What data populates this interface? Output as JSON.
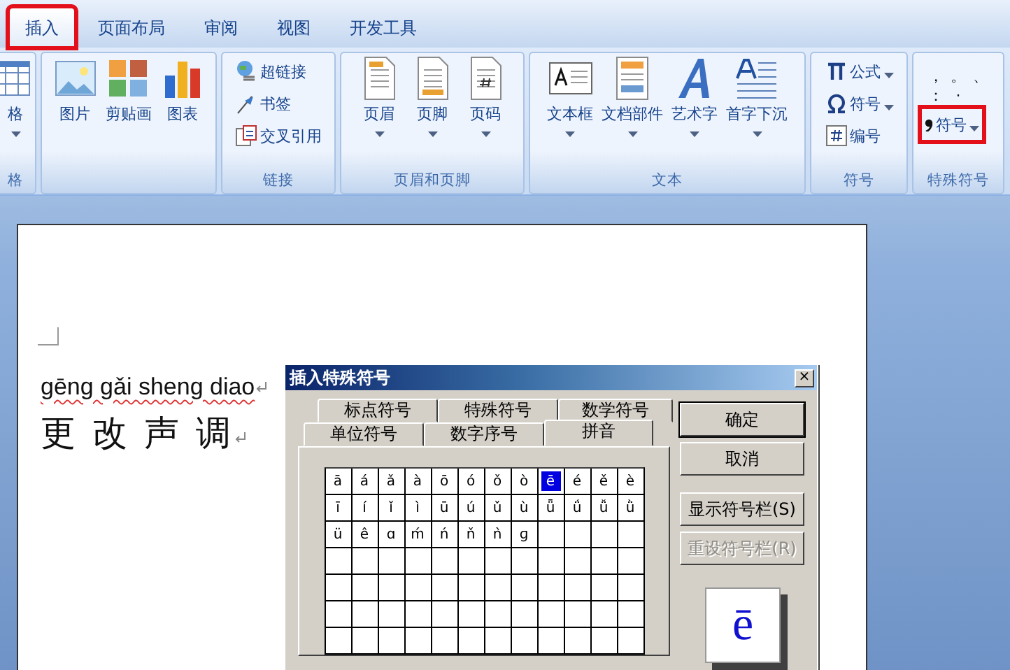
{
  "ribbon_tabs": [
    {
      "label": "插入",
      "selected": true,
      "highlighted": true
    },
    {
      "label": "页面布局",
      "selected": false,
      "highlighted": false
    },
    {
      "label": "审阅",
      "selected": false,
      "highlighted": false
    },
    {
      "label": "视图",
      "selected": false,
      "highlighted": false
    },
    {
      "label": "开发工具",
      "selected": false,
      "highlighted": false
    }
  ],
  "groups": [
    {
      "label": "格",
      "items": [
        {
          "kind": "large",
          "label": "格",
          "caret": true
        }
      ]
    },
    {
      "items": [
        {
          "kind": "large",
          "label": "图片",
          "caret": false
        },
        {
          "kind": "large",
          "label": "剪贴画",
          "caret": false
        },
        {
          "kind": "large",
          "label": "图表",
          "caret": false
        }
      ]
    },
    {
      "label": "链接",
      "items": [
        {
          "kind": "small",
          "label": "超链接",
          "caret": false
        },
        {
          "kind": "small",
          "label": "书签",
          "caret": false
        },
        {
          "kind": "small",
          "label": "交叉引用",
          "caret": false
        }
      ]
    },
    {
      "label": "页眉和页脚",
      "items": [
        {
          "kind": "large",
          "label": "页眉",
          "caret": true
        },
        {
          "kind": "large",
          "label": "页脚",
          "caret": true
        },
        {
          "kind": "large",
          "label": "页码",
          "caret": true
        }
      ]
    },
    {
      "label": "文本",
      "items": [
        {
          "kind": "large",
          "label": "文本框",
          "caret": true
        },
        {
          "kind": "large",
          "label": "文档部件",
          "caret": true
        },
        {
          "kind": "large",
          "label": "艺术字",
          "caret": true
        },
        {
          "kind": "large",
          "label": "首字下沉",
          "caret": true
        }
      ]
    },
    {
      "label": "符号",
      "items": [
        {
          "kind": "small",
          "label": "公式",
          "caret": true
        },
        {
          "kind": "small",
          "label": "符号",
          "caret": true
        },
        {
          "kind": "small",
          "label": "编号",
          "caret": false
        }
      ]
    },
    {
      "label": "特殊符号",
      "items": [
        {
          "kind": "punct",
          "label": "，"
        },
        {
          "kind": "punct",
          "label": "。"
        },
        {
          "kind": "punct",
          "label": "、"
        },
        {
          "kind": "punct",
          "label": "："
        },
        {
          "kind": "punct",
          "label": "·"
        },
        {
          "kind": "bullet",
          "label": "符号",
          "caret": true,
          "highlighted": true
        }
      ]
    }
  ],
  "document": {
    "lines": [
      "gēng gǎi sheng diao",
      "更 改 声 调"
    ]
  },
  "dialog": {
    "title": "插入特殊符号",
    "close": "×",
    "tab_rows": [
      [
        {
          "label": "标点符号",
          "selected": false
        },
        {
          "label": "特殊符号",
          "selected": false
        },
        {
          "label": "数学符号",
          "selected": false
        }
      ],
      [
        {
          "label": "单位符号",
          "selected": false
        },
        {
          "label": "数字序号",
          "selected": false
        },
        {
          "label": "拼音",
          "selected": true
        }
      ]
    ],
    "symbols": [
      {
        "char": "ā",
        "selected": false
      },
      {
        "char": "á",
        "selected": false
      },
      {
        "char": "ǎ",
        "selected": false
      },
      {
        "char": "à",
        "selected": false
      },
      {
        "char": "ō",
        "selected": false
      },
      {
        "char": "ó",
        "selected": false
      },
      {
        "char": "ǒ",
        "selected": false
      },
      {
        "char": "ò",
        "selected": false
      },
      {
        "char": "ē",
        "selected": true
      },
      {
        "char": "é",
        "selected": false
      },
      {
        "char": "ě",
        "selected": false
      },
      {
        "char": "è",
        "selected": false
      },
      {
        "char": "ī",
        "selected": false
      },
      {
        "char": "í",
        "selected": false
      },
      {
        "char": "ǐ",
        "selected": false
      },
      {
        "char": "ì",
        "selected": false
      },
      {
        "char": "ū",
        "selected": false
      },
      {
        "char": "ú",
        "selected": false
      },
      {
        "char": "ǔ",
        "selected": false
      },
      {
        "char": "ù",
        "selected": false
      },
      {
        "char": "ǖ",
        "selected": false
      },
      {
        "char": "ǘ",
        "selected": false
      },
      {
        "char": "ǚ",
        "selected": false
      },
      {
        "char": "ǜ",
        "selected": false
      },
      {
        "char": "ü",
        "selected": false
      },
      {
        "char": "ê",
        "selected": false
      },
      {
        "char": "ɑ",
        "selected": false
      },
      {
        "char": "ḿ",
        "selected": false
      },
      {
        "char": "ń",
        "selected": false
      },
      {
        "char": "ň",
        "selected": false
      },
      {
        "char": "ǹ",
        "selected": false
      },
      {
        "char": "ɡ",
        "selected": false
      }
    ],
    "buttons": [
      {
        "label": "确定",
        "disabled": false,
        "default": true
      },
      {
        "label": "取消",
        "disabled": false,
        "default": false
      },
      {
        "label": "显示符号栏(S)",
        "disabled": false,
        "default": false
      },
      {
        "label": "重设符号栏(R)",
        "disabled": true,
        "default": false
      }
    ],
    "preview": "ē"
  }
}
